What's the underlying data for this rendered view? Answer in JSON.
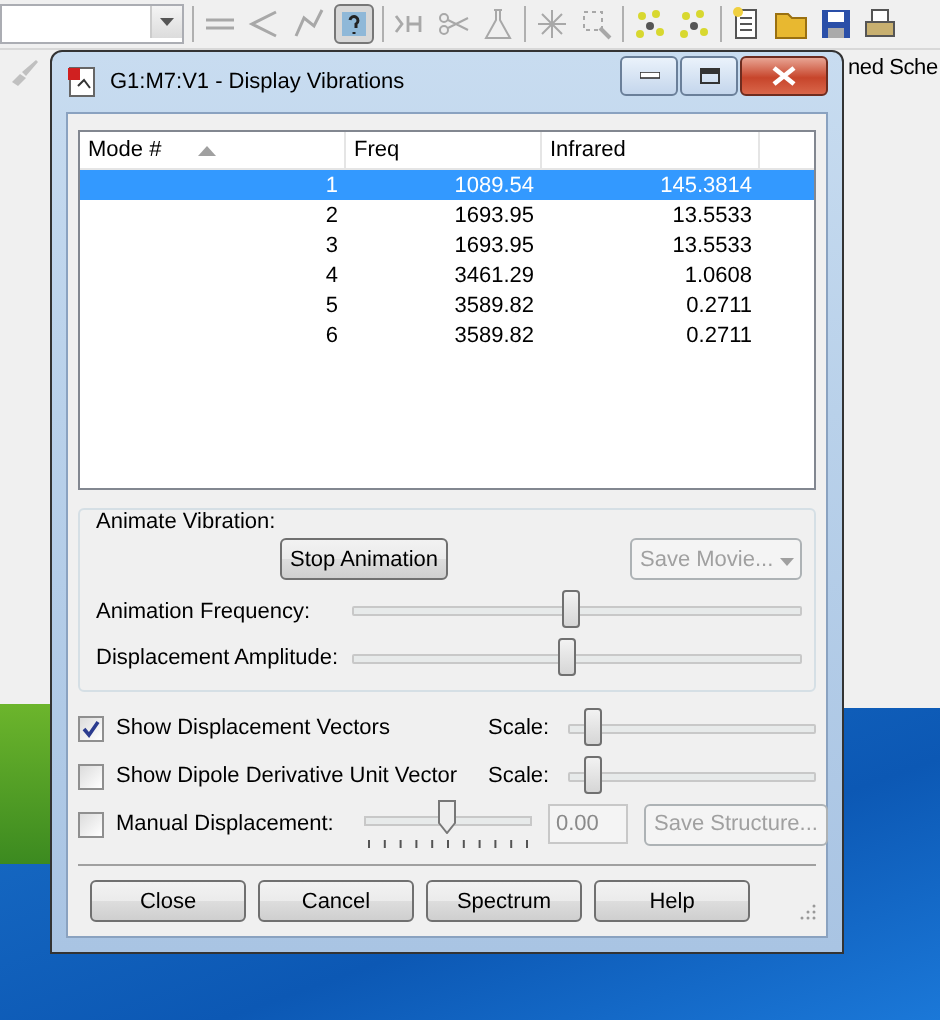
{
  "background_window": {
    "partial_text": "ned Sche"
  },
  "dialog": {
    "title": "G1:M7:V1 - Display Vibrations"
  },
  "table": {
    "columns": [
      {
        "label": "Mode #",
        "sorted": true
      },
      {
        "label": "Freq",
        "sorted": false
      },
      {
        "label": "Infrared",
        "sorted": false
      }
    ],
    "rows": [
      {
        "cells": [
          "1",
          "1089.54",
          "145.3814"
        ],
        "selected": true
      },
      {
        "cells": [
          "2",
          "1693.95",
          "13.5533"
        ],
        "selected": false
      },
      {
        "cells": [
          "3",
          "1693.95",
          "13.5533"
        ],
        "selected": false
      },
      {
        "cells": [
          "4",
          "3461.29",
          "1.0608"
        ],
        "selected": false
      },
      {
        "cells": [
          "5",
          "3589.82",
          "0.2711"
        ],
        "selected": false
      },
      {
        "cells": [
          "6",
          "3589.82",
          "0.2711"
        ],
        "selected": false
      }
    ]
  },
  "animate": {
    "label": "Animate Vibration:",
    "stop_button": "Stop Animation",
    "save_movie": {
      "label": "Save Movie...",
      "disabled": true
    },
    "sliders": [
      {
        "label": "Animation Frequency:",
        "level": 0.49
      },
      {
        "label": "Displacement Amplitude:",
        "level": 0.48
      }
    ]
  },
  "options": [
    {
      "kind": "scale",
      "label": "Show Displacement Vectors",
      "checked": true,
      "scale_label": "Scale:",
      "level": 0.1
    },
    {
      "kind": "scale",
      "label": "Show Dipole Derivative Unit Vector",
      "checked": false,
      "scale_label": "Scale:",
      "level": 0.1
    },
    {
      "kind": "manual",
      "label": "Manual Displacement:",
      "checked": false,
      "level": 0.5,
      "value": "0.00",
      "button": "Save Structure...",
      "disabled": true
    }
  ],
  "buttons": [
    "Close",
    "Cancel",
    "Spectrum",
    "Help"
  ]
}
